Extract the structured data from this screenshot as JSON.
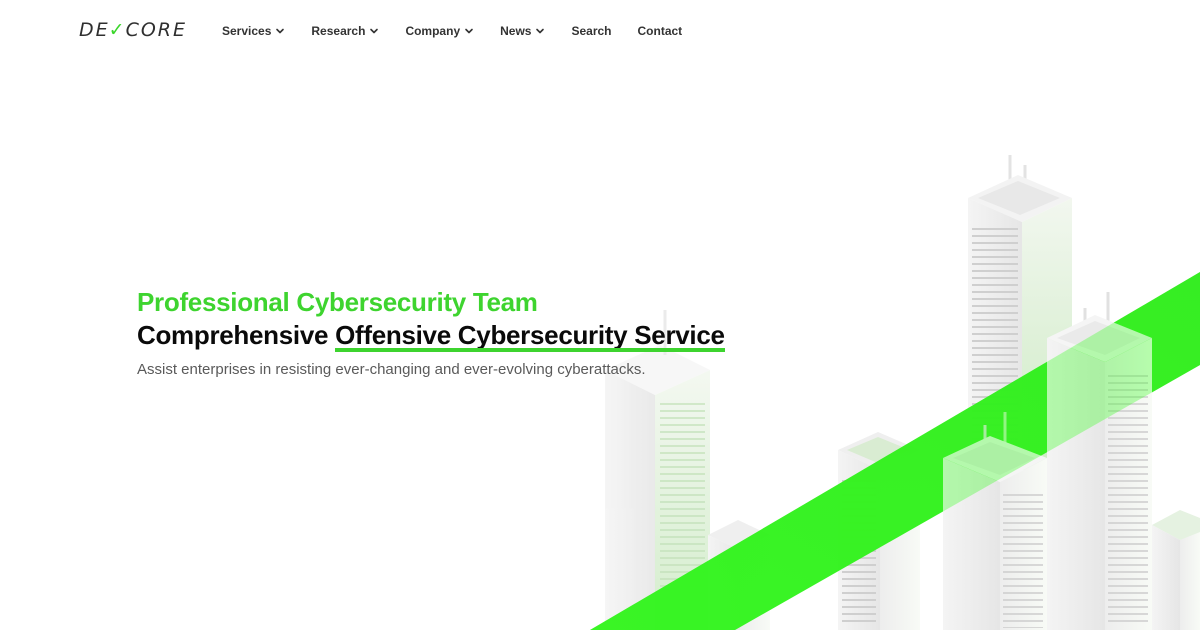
{
  "brand": {
    "logo_text_left": "DE",
    "logo_text_right": "CORE",
    "logo_mark": "✓"
  },
  "nav": {
    "items": [
      {
        "label": "Services",
        "has_dropdown": true
      },
      {
        "label": "Research",
        "has_dropdown": true
      },
      {
        "label": "Company",
        "has_dropdown": true
      },
      {
        "label": "News",
        "has_dropdown": true
      },
      {
        "label": "Search",
        "has_dropdown": false
      },
      {
        "label": "Contact",
        "has_dropdown": false
      }
    ]
  },
  "hero": {
    "eyebrow": "Professional Cybersecurity Team",
    "title_plain": "Comprehensive ",
    "title_highlight": "Offensive Cybersecurity Service",
    "subtitle": "Assist enterprises in resisting ever-changing and ever-evolving cyberattacks."
  },
  "colors": {
    "accent": "#3ed42f",
    "text_dark": "#0a0a0a",
    "text_muted": "#5a5a5a",
    "background": "#ffffff"
  },
  "icons": {
    "dropdown": "chevron-down-icon",
    "logo": "devcore-logo"
  }
}
